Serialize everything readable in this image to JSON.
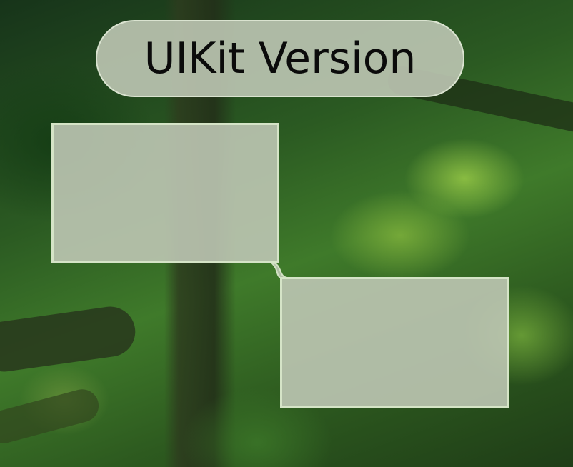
{
  "title_pill": {
    "label": "UIKit Version"
  },
  "colors": {
    "glass_fill": "#bec6b4",
    "glass_border": "#d7e6c8",
    "label_text": "#0b0b0b"
  }
}
